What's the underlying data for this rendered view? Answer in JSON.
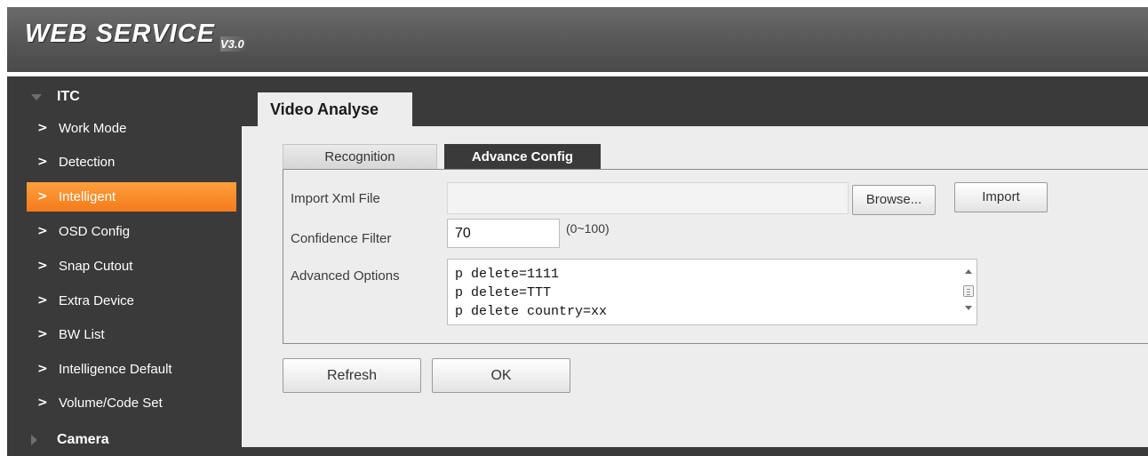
{
  "header": {
    "logo_text": "WEB  SERVICE",
    "logo_version": "V3.0"
  },
  "sidebar": {
    "groups": [
      {
        "label": "ITC",
        "expanded": true
      },
      {
        "label": "Camera",
        "expanded": false
      }
    ],
    "items": [
      {
        "label": "Work Mode"
      },
      {
        "label": "Detection"
      },
      {
        "label": "Intelligent"
      },
      {
        "label": "OSD Config"
      },
      {
        "label": "Snap Cutout"
      },
      {
        "label": "Extra Device"
      },
      {
        "label": "BW List"
      },
      {
        "label": "Intelligence Default"
      },
      {
        "label": "Volume/Code Set"
      }
    ],
    "chevron": ">"
  },
  "main": {
    "page_tab": "Video Analyse",
    "subtabs": [
      {
        "label": "Recognition",
        "active": false
      },
      {
        "label": "Advance Config",
        "active": true
      }
    ],
    "import_xml": {
      "label": "Import Xml File",
      "path_value": "",
      "browse_label": "Browse...",
      "import_label": "Import"
    },
    "confidence": {
      "label": "Confidence Filter",
      "value": "70",
      "range_hint": "(0~100)"
    },
    "advanced_options": {
      "label": "Advanced Options",
      "text": "p delete=1111\np delete=TTT\np delete country=xx"
    },
    "refresh_label": "Refresh",
    "ok_label": "OK"
  },
  "colors": {
    "sidebar_bg": "#3a3a3a",
    "active_item": "#f47a1a",
    "panel_bg": "#ededed"
  },
  "icons": {
    "group_expanded": "triangle-down-icon",
    "group_collapsed": "triangle-right-icon",
    "item": "chevron-right-icon",
    "scroll_grip": "scroll-grip-icon"
  }
}
